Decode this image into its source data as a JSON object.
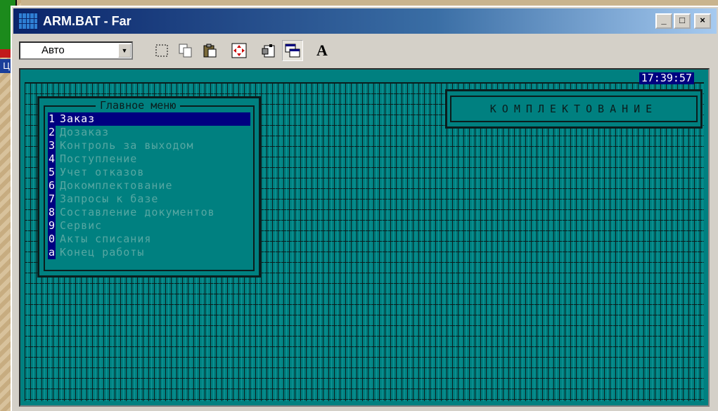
{
  "desktop": {
    "label": "Ц"
  },
  "window": {
    "title": "ARM.BAT - Far",
    "buttons": {
      "minimize": "_",
      "maximize": "□",
      "close": "×"
    }
  },
  "toolbar": {
    "font_combo_value": "Авто",
    "font_button_label": "A"
  },
  "console": {
    "clock": "17:39:57",
    "status_title": "КОМПЛЕКТОВАНИЕ",
    "menu": {
      "title": "Главное меню",
      "items": [
        {
          "key": "1",
          "label": "Заказ",
          "selected": true
        },
        {
          "key": "2",
          "label": "Дозаказ"
        },
        {
          "key": "3",
          "label": "Контроль за выходом"
        },
        {
          "key": "4",
          "label": "Поступление"
        },
        {
          "key": "5",
          "label": "Учет отказов"
        },
        {
          "key": "6",
          "label": "Докомплектование"
        },
        {
          "key": "7",
          "label": "Запросы к базе"
        },
        {
          "key": "8",
          "label": "Составление документов"
        },
        {
          "key": "9",
          "label": "Сервис"
        },
        {
          "key": "0",
          "label": "Акты списания"
        },
        {
          "key": "a",
          "label": "Конец работы"
        }
      ]
    }
  },
  "colors": {
    "console_bg": "#008080",
    "selection_bg": "#000080",
    "title_bar": "#0a246a"
  }
}
